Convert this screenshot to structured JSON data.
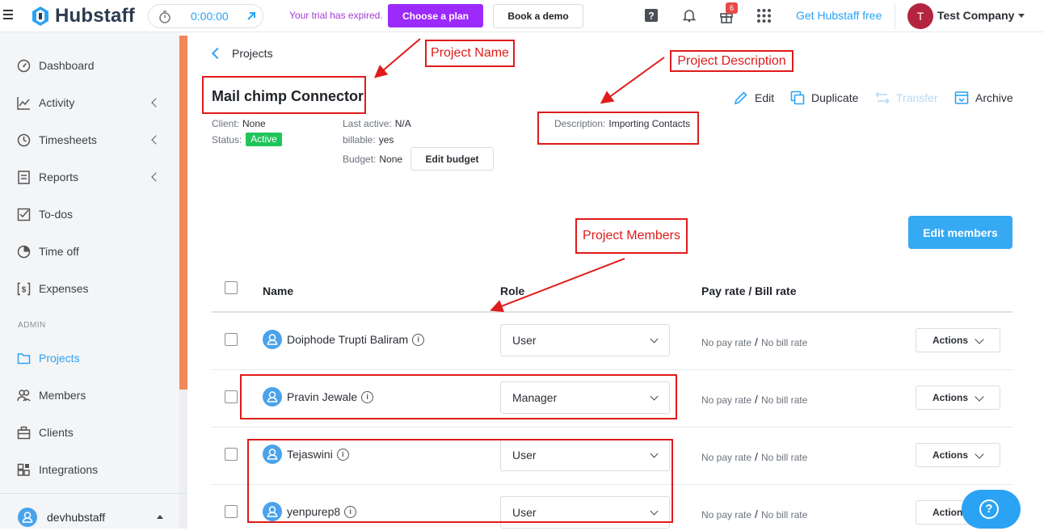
{
  "topbar": {
    "logo_text": "Hubstaff",
    "timer": "0:00:00",
    "trial_text": "Your trial has expired.",
    "choose_plan": "Choose a plan",
    "book_demo": "Book a demo",
    "gift_badge": "6",
    "get_free": "Get Hubstaff free",
    "company_initial": "T",
    "company_name": "Test Company"
  },
  "sidebar": {
    "items": [
      {
        "label": "Dashboard",
        "icon": "dashboard-icon"
      },
      {
        "label": "Activity",
        "icon": "activity-icon"
      },
      {
        "label": "Timesheets",
        "icon": "clock-icon"
      },
      {
        "label": "Reports",
        "icon": "reports-icon"
      },
      {
        "label": "To-dos",
        "icon": "todo-icon"
      },
      {
        "label": "Time off",
        "icon": "pie-icon"
      },
      {
        "label": "Expenses",
        "icon": "dollar-icon"
      }
    ],
    "admin_label": "ADMIN",
    "admin_items": [
      {
        "label": "Projects",
        "icon": "folder-icon"
      },
      {
        "label": "Members",
        "icon": "members-icon"
      },
      {
        "label": "Clients",
        "icon": "clients-icon"
      },
      {
        "label": "Integrations",
        "icon": "integrations-icon"
      }
    ],
    "user": "devhubstaff"
  },
  "project": {
    "breadcrumb": "Projects",
    "title": "Mail chimp Connector",
    "client_label": "Client:",
    "client": "None",
    "status_label": "Status:",
    "status": "Active",
    "last_active_label": "Last active:",
    "last_active": "N/A",
    "billable_label": "billable:",
    "billable": "yes",
    "budget_label": "Budget:",
    "budget": "None",
    "edit_budget": "Edit budget",
    "description_label": "Description:",
    "description": "Importing Contacts",
    "actions": {
      "edit": "Edit",
      "duplicate": "Duplicate",
      "transfer": "Transfer",
      "archive": "Archive"
    }
  },
  "members": {
    "edit_members": "Edit members",
    "columns": [
      "Name",
      "Role",
      "Pay rate / Bill rate"
    ],
    "pay_rate": "No pay rate",
    "bill_rate": "No bill rate",
    "actions_label": "Actions",
    "rows": [
      {
        "name": "Doiphode Trupti Baliram",
        "role": "User"
      },
      {
        "name": "Pravin Jewale",
        "role": "Manager"
      },
      {
        "name": "Tejaswini",
        "role": "User"
      },
      {
        "name": "yenpurep8",
        "role": "User"
      }
    ]
  },
  "annotations": {
    "project_name": "Project Name",
    "project_description": "Project Description",
    "project_members": "Project Members"
  },
  "colors": {
    "accent": "#2aa3f4",
    "plan_purple": "#9c2bfb",
    "active_green": "#20c55a",
    "annotation_red": "#e01b1b",
    "sidebar_orange": "#f0885b"
  }
}
